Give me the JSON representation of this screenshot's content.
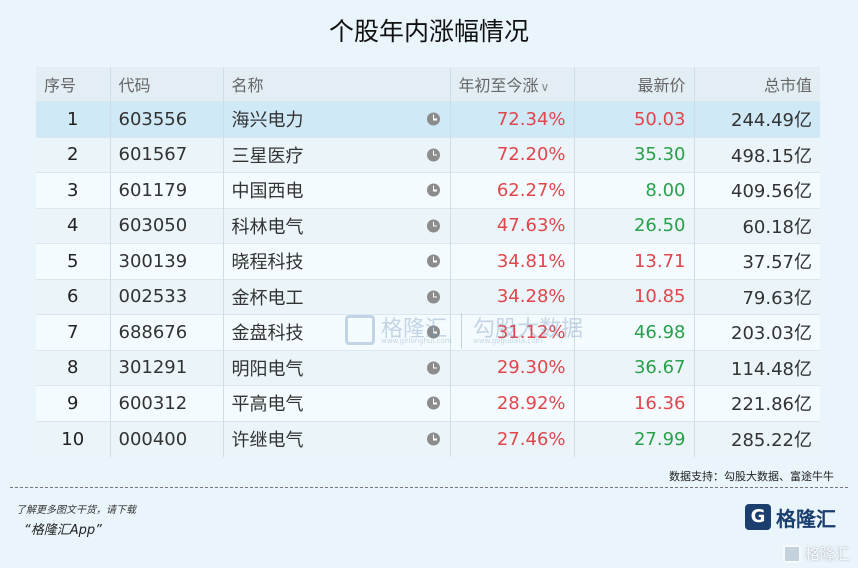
{
  "title": "个股年内涨幅情况",
  "table": {
    "headers": [
      "序号",
      "代码",
      "名称",
      "年初至今涨",
      "最新价",
      "总市值"
    ],
    "sort_caret": "∨",
    "rows": [
      {
        "idx": "1",
        "code": "603556",
        "name": "海兴电力",
        "pct": "72.34%",
        "price": "50.03",
        "dir": "up",
        "cap": "244.49亿",
        "selected": true
      },
      {
        "idx": "2",
        "code": "601567",
        "name": "三星医疗",
        "pct": "72.20%",
        "price": "35.30",
        "dir": "down",
        "cap": "498.15亿"
      },
      {
        "idx": "3",
        "code": "601179",
        "name": "中国西电",
        "pct": "62.27%",
        "price": "8.00",
        "dir": "down",
        "cap": "409.56亿"
      },
      {
        "idx": "4",
        "code": "603050",
        "name": "科林电气",
        "pct": "47.63%",
        "price": "26.50",
        "dir": "down",
        "cap": "60.18亿"
      },
      {
        "idx": "5",
        "code": "300139",
        "name": "晓程科技",
        "pct": "34.81%",
        "price": "13.71",
        "dir": "up",
        "cap": "37.57亿"
      },
      {
        "idx": "6",
        "code": "002533",
        "name": "金杯电工",
        "pct": "34.28%",
        "price": "10.85",
        "dir": "up",
        "cap": "79.63亿"
      },
      {
        "idx": "7",
        "code": "688676",
        "name": "金盘科技",
        "pct": "31.12%",
        "price": "46.98",
        "dir": "down",
        "cap": "203.03亿"
      },
      {
        "idx": "8",
        "code": "301291",
        "name": "明阳电气",
        "pct": "29.30%",
        "price": "36.67",
        "dir": "down",
        "cap": "114.48亿"
      },
      {
        "idx": "9",
        "code": "600312",
        "name": "平高电气",
        "pct": "28.92%",
        "price": "16.36",
        "dir": "up",
        "cap": "221.86亿"
      },
      {
        "idx": "10",
        "code": "000400",
        "name": "许继电气",
        "pct": "27.46%",
        "price": "27.99",
        "dir": "down",
        "cap": "285.22亿"
      }
    ]
  },
  "watermark": {
    "brand": "格隆汇",
    "brand_url": "www.gelonghui.com",
    "partner": "勾股大数据",
    "partner_url": "www.gogudata.com"
  },
  "source": "数据支持：勾股大数据、富途牛牛",
  "footer": {
    "line1": "了解更多图文干货，请下载",
    "line2": "“格隆汇App”",
    "brand": "格隆汇",
    "corner": "格隆汇"
  },
  "colors": {
    "up": "#e0464b",
    "down": "#2aa04a",
    "background": "#e9f5fb"
  },
  "icons": {
    "time": "clock-icon",
    "sort": "chevron-down-icon"
  }
}
